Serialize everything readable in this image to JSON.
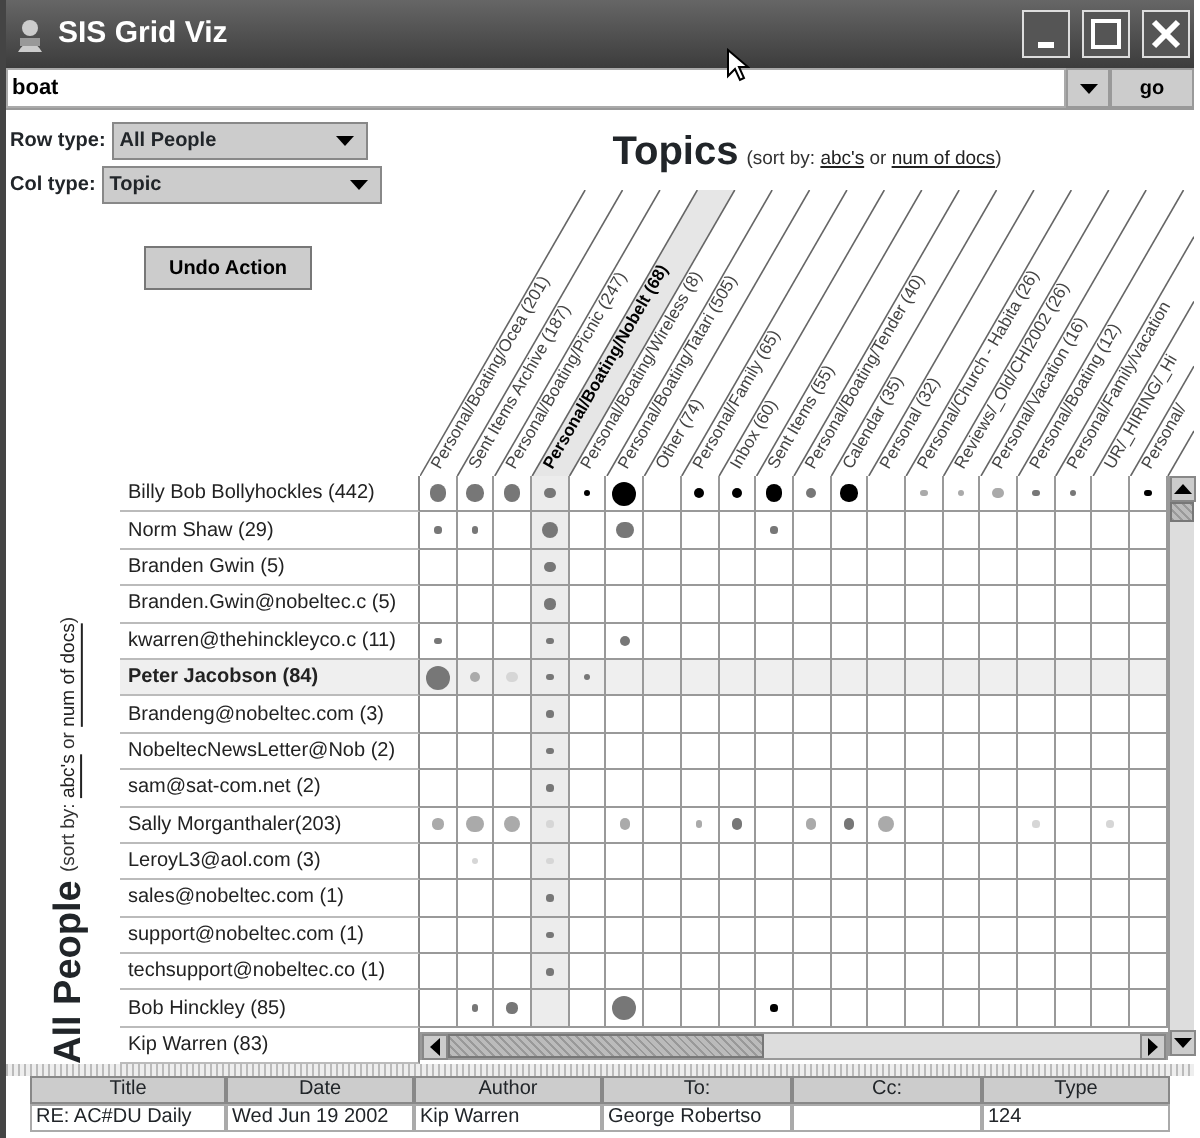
{
  "window": {
    "title": "SIS Grid Viz"
  },
  "search": {
    "value": "boat",
    "button": "go"
  },
  "row_type": {
    "label": "Row type:",
    "value": "All People"
  },
  "col_type": {
    "label": "Col type:",
    "value": "Topic"
  },
  "undo_button": "Undo Action",
  "columns_title": {
    "title": "Topics",
    "sort": [
      {
        "kind": "text",
        "text": "(sort by: "
      },
      {
        "kind": "link",
        "text": "abc's"
      },
      {
        "kind": "text",
        "text": " or "
      },
      {
        "kind": "link",
        "text": "num of docs"
      },
      {
        "kind": "text",
        "text": ")"
      }
    ]
  },
  "rows_title": {
    "title": "All People",
    "sort": [
      {
        "kind": "text",
        "text": "(sort by: "
      },
      {
        "kind": "link",
        "text": "abc's"
      },
      {
        "kind": "text",
        "text": " or "
      },
      {
        "kind": "link",
        "text": "num of docs"
      },
      {
        "kind": "text",
        "text": ")"
      }
    ]
  },
  "columns": [
    {
      "label": "Personal/Boating/Ocea (201)",
      "selected": false
    },
    {
      "label": "Sent Items Archive (187)",
      "selected": false
    },
    {
      "label": "Personal/Boating/Picnic (247)",
      "selected": false
    },
    {
      "label": "Personal/Boating/Nobelt (68)",
      "selected": true
    },
    {
      "label": "Personal/Boating/Wireless (8)",
      "selected": false
    },
    {
      "label": "Personal/Boating/Tatari (505)",
      "selected": false
    },
    {
      "label": "Other (74)",
      "selected": false
    },
    {
      "label": "Personal/Family (65)",
      "selected": false
    },
    {
      "label": "Inbox (60)",
      "selected": false
    },
    {
      "label": "Sent Items (55)",
      "selected": false
    },
    {
      "label": "Personal/Boating/Tender (40)",
      "selected": false
    },
    {
      "label": "Calendar (35)",
      "selected": false
    },
    {
      "label": "Personal (32)",
      "selected": false
    },
    {
      "label": "Personal/Church - Habita (26)",
      "selected": false
    },
    {
      "label": "Reviews/_Old/CHI2002 (26)",
      "selected": false
    },
    {
      "label": "Personal/Vacation (16)",
      "selected": false
    },
    {
      "label": "Personal/Boating (12)",
      "selected": false
    },
    {
      "label": "Personal/Family/vacation",
      "selected": false
    },
    {
      "label": "UR/_HIRING/_Hi",
      "selected": false
    },
    {
      "label": "Personal/",
      "selected": false
    }
  ],
  "rows": [
    {
      "label": "Billy Bob Bollyhockles (442)",
      "selected": false,
      "cells": [
        {
          "kind": "medium",
          "color": "#777777"
        },
        {
          "kind": "medium",
          "color": "#777777"
        },
        {
          "kind": "medium",
          "color": "#777777"
        },
        {
          "kind": "small",
          "color": "#777777"
        },
        {
          "kind": "tiny",
          "color": "#000000"
        },
        {
          "kind": "large",
          "color": "#000000"
        },
        null,
        {
          "kind": "small",
          "color": "#000000"
        },
        {
          "kind": "small",
          "color": "#000000"
        },
        {
          "kind": "medium",
          "color": "#000000"
        },
        {
          "kind": "small",
          "color": "#777777"
        },
        {
          "kind": "medium",
          "color": "#000000"
        },
        null,
        {
          "kind": "tiny",
          "color": "#aaaaaa"
        },
        {
          "kind": "tiny",
          "color": "#aaaaaa"
        },
        {
          "kind": "small",
          "color": "#aaaaaa"
        },
        {
          "kind": "tiny",
          "color": "#777777"
        },
        {
          "kind": "tiny",
          "color": "#777777"
        },
        null,
        {
          "kind": "tiny",
          "color": "#000000"
        }
      ]
    },
    {
      "label": "Norm Shaw (29)",
      "selected": false,
      "cells": [
        {
          "kind": "tiny",
          "color": "#777777"
        },
        {
          "kind": "tiny",
          "color": "#777777"
        },
        null,
        {
          "kind": "medium",
          "color": "#777777"
        },
        null,
        {
          "kind": "medium",
          "color": "#777777"
        },
        null,
        null,
        null,
        {
          "kind": "tiny",
          "color": "#777777"
        },
        null,
        null,
        null,
        null,
        null,
        null,
        null,
        null,
        null,
        null
      ]
    },
    {
      "label": "Branden Gwin (5)",
      "selected": false,
      "cells": [
        null,
        null,
        null,
        {
          "kind": "small",
          "color": "#777777"
        },
        null,
        null,
        null,
        null,
        null,
        null,
        null,
        null,
        null,
        null,
        null,
        null,
        null,
        null,
        null,
        null
      ]
    },
    {
      "label": "Branden.Gwin@nobeltec.c (5)",
      "selected": false,
      "cells": [
        null,
        null,
        null,
        {
          "kind": "small",
          "color": "#777777"
        },
        null,
        null,
        null,
        null,
        null,
        null,
        null,
        null,
        null,
        null,
        null,
        null,
        null,
        null,
        null,
        null
      ]
    },
    {
      "label": "kwarren@thehinckleyco.c (11)",
      "selected": false,
      "cells": [
        {
          "kind": "tiny",
          "color": "#777777"
        },
        null,
        null,
        {
          "kind": "tiny",
          "color": "#777777"
        },
        null,
        {
          "kind": "small",
          "color": "#777777"
        },
        null,
        null,
        null,
        null,
        null,
        null,
        null,
        null,
        null,
        null,
        null,
        null,
        null,
        null
      ]
    },
    {
      "label": "Peter Jacobson (84)",
      "selected": true,
      "cells": [
        {
          "kind": "large",
          "color": "#777777"
        },
        {
          "kind": "small",
          "color": "#aaaaaa"
        },
        {
          "kind": "small",
          "color": "#d6d6d6"
        },
        {
          "kind": "tiny",
          "color": "#777777"
        },
        {
          "kind": "tiny",
          "color": "#777777"
        },
        null,
        null,
        null,
        null,
        null,
        null,
        null,
        null,
        null,
        null,
        null,
        null,
        null,
        null,
        null
      ]
    },
    {
      "label": "Brandeng@nobeltec.com (3)",
      "selected": false,
      "cells": [
        null,
        null,
        null,
        {
          "kind": "tiny",
          "color": "#777777"
        },
        null,
        null,
        null,
        null,
        null,
        null,
        null,
        null,
        null,
        null,
        null,
        null,
        null,
        null,
        null,
        null
      ]
    },
    {
      "label": "NobeltecNewsLetter@Nob (2)",
      "selected": false,
      "cells": [
        null,
        null,
        null,
        {
          "kind": "tiny",
          "color": "#777777"
        },
        null,
        null,
        null,
        null,
        null,
        null,
        null,
        null,
        null,
        null,
        null,
        null,
        null,
        null,
        null,
        null
      ]
    },
    {
      "label": "sam@sat-com.net (2)",
      "selected": false,
      "cells": [
        null,
        null,
        null,
        {
          "kind": "tiny",
          "color": "#777777"
        },
        null,
        null,
        null,
        null,
        null,
        null,
        null,
        null,
        null,
        null,
        null,
        null,
        null,
        null,
        null,
        null
      ]
    },
    {
      "label": "Sally Morganthaler(203)",
      "selected": false,
      "cells": [
        {
          "kind": "small",
          "color": "#aaaaaa"
        },
        {
          "kind": "medium",
          "color": "#aaaaaa"
        },
        {
          "kind": "medium",
          "color": "#aaaaaa"
        },
        {
          "kind": "tiny",
          "color": "#d6d6d6"
        },
        null,
        {
          "kind": "small",
          "color": "#aaaaaa"
        },
        null,
        {
          "kind": "tiny",
          "color": "#aaaaaa"
        },
        {
          "kind": "small",
          "color": "#777777"
        },
        null,
        {
          "kind": "small",
          "color": "#aaaaaa"
        },
        {
          "kind": "small",
          "color": "#777777"
        },
        {
          "kind": "medium",
          "color": "#aaaaaa"
        },
        null,
        null,
        null,
        {
          "kind": "tiny",
          "color": "#d6d6d6"
        },
        null,
        {
          "kind": "tiny",
          "color": "#d6d6d6"
        },
        null
      ]
    },
    {
      "label": "LeroyL3@aol.com (3)",
      "selected": false,
      "cells": [
        null,
        {
          "kind": "tiny",
          "color": "#d6d6d6"
        },
        null,
        {
          "kind": "tiny",
          "color": "#d6d6d6"
        },
        null,
        null,
        null,
        null,
        null,
        null,
        null,
        null,
        null,
        null,
        null,
        null,
        null,
        null,
        null,
        null
      ]
    },
    {
      "label": "sales@nobeltec.com (1)",
      "selected": false,
      "cells": [
        null,
        null,
        null,
        {
          "kind": "tiny",
          "color": "#777777"
        },
        null,
        null,
        null,
        null,
        null,
        null,
        null,
        null,
        null,
        null,
        null,
        null,
        null,
        null,
        null,
        null
      ]
    },
    {
      "label": "support@nobeltec.com (1)",
      "selected": false,
      "cells": [
        null,
        null,
        null,
        {
          "kind": "tiny",
          "color": "#777777"
        },
        null,
        null,
        null,
        null,
        null,
        null,
        null,
        null,
        null,
        null,
        null,
        null,
        null,
        null,
        null,
        null
      ]
    },
    {
      "label": "techsupport@nobeltec.co (1)",
      "selected": false,
      "cells": [
        null,
        null,
        null,
        {
          "kind": "tiny",
          "color": "#777777"
        },
        null,
        null,
        null,
        null,
        null,
        null,
        null,
        null,
        null,
        null,
        null,
        null,
        null,
        null,
        null,
        null
      ]
    },
    {
      "label": "Bob Hinckley (85)",
      "selected": false,
      "cells": [
        null,
        {
          "kind": "tiny",
          "color": "#777777"
        },
        {
          "kind": "small",
          "color": "#777777"
        },
        null,
        null,
        {
          "kind": "large",
          "color": "#777777"
        },
        null,
        null,
        null,
        {
          "kind": "tiny",
          "color": "#000000"
        },
        null,
        null,
        null,
        null,
        null,
        null,
        null,
        null,
        null,
        null
      ]
    },
    {
      "label": "Kip Warren (83)",
      "selected": false
    }
  ],
  "documents": {
    "columns": [
      "Title",
      "Date",
      "Author",
      "To:",
      "Cc:",
      "Type"
    ],
    "rows": [
      [
        "RE: AC#DU Daily",
        "Wed Jun 19 2002",
        "Kip Warren",
        "George Robertso",
        null,
        "124"
      ]
    ]
  }
}
